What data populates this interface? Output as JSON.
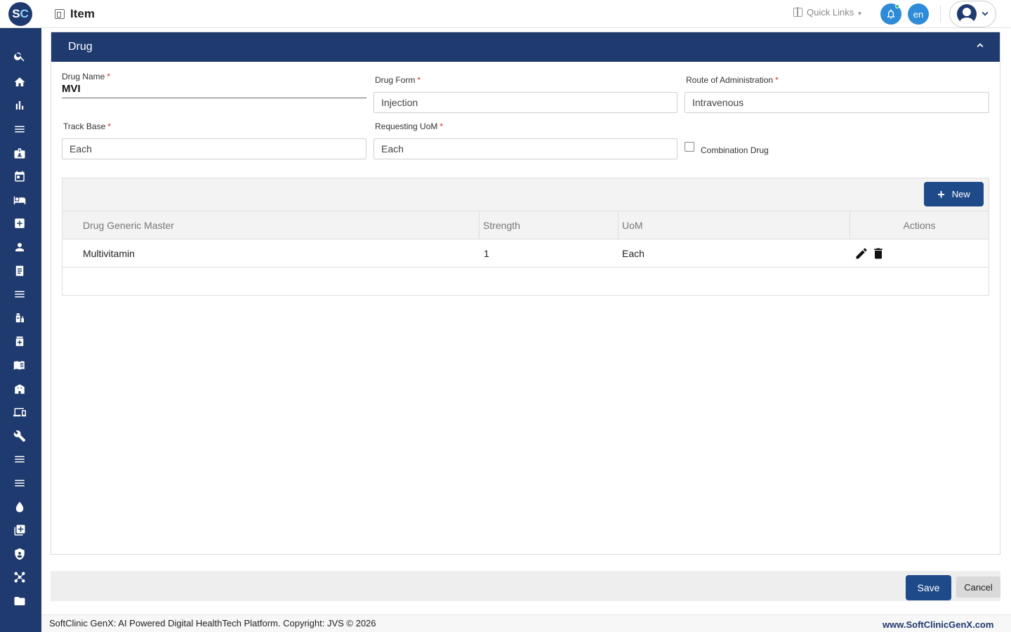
{
  "header": {
    "logo_text_s": "S",
    "logo_text_c": "C",
    "title": "Item",
    "quick_links": "Quick Links",
    "language": "en"
  },
  "sidebar": {
    "icons": [
      "search-icon",
      "home-icon",
      "bar-chart-icon",
      "menu-icon",
      "id-badge-icon",
      "calendar-icon",
      "bed-icon",
      "medical-plus-icon",
      "person-icon",
      "receipt-icon",
      "menu-icon",
      "medication-icon",
      "medicine-bottle-icon",
      "book-icon",
      "building-icon",
      "devices-icon",
      "wrench-icon",
      "menu-icon",
      "menu-icon",
      "drop-icon",
      "add-box-icon",
      "shield-icon",
      "network-icon",
      "folder-icon"
    ]
  },
  "panel": {
    "title": "Drug"
  },
  "form": {
    "drug_name_label": "Drug Name",
    "drug_name_value": "MVI",
    "drug_form_label": "Drug Form",
    "drug_form_value": "Injection",
    "route_label": "Route of Administration",
    "route_value": "Intravenous",
    "track_base_label": "Track Base",
    "track_base_value": "Each",
    "requesting_uom_label": "Requesting UoM",
    "requesting_uom_value": "Each",
    "combination_label": "Combination Drug",
    "required_mark": "*"
  },
  "grid": {
    "new_button": "New",
    "columns": [
      "Drug Generic Master",
      "Strength",
      "UoM",
      "Actions"
    ],
    "rows": [
      {
        "generic": "Multivitamin",
        "strength": "1",
        "uom": "Each"
      }
    ]
  },
  "actions": {
    "save": "Save",
    "cancel": "Cancel"
  },
  "footer": {
    "copyright": "SoftClinic GenX: AI Powered Digital HealthTech Platform. Copyright: JVS © 2026",
    "site": "www.SoftClinicGenX.com"
  },
  "colors": {
    "brand_navy": "#1f3a6e",
    "button_blue": "#1f4a8a",
    "accent_blue": "#2e8bd8",
    "required_red": "#d32f2f"
  }
}
